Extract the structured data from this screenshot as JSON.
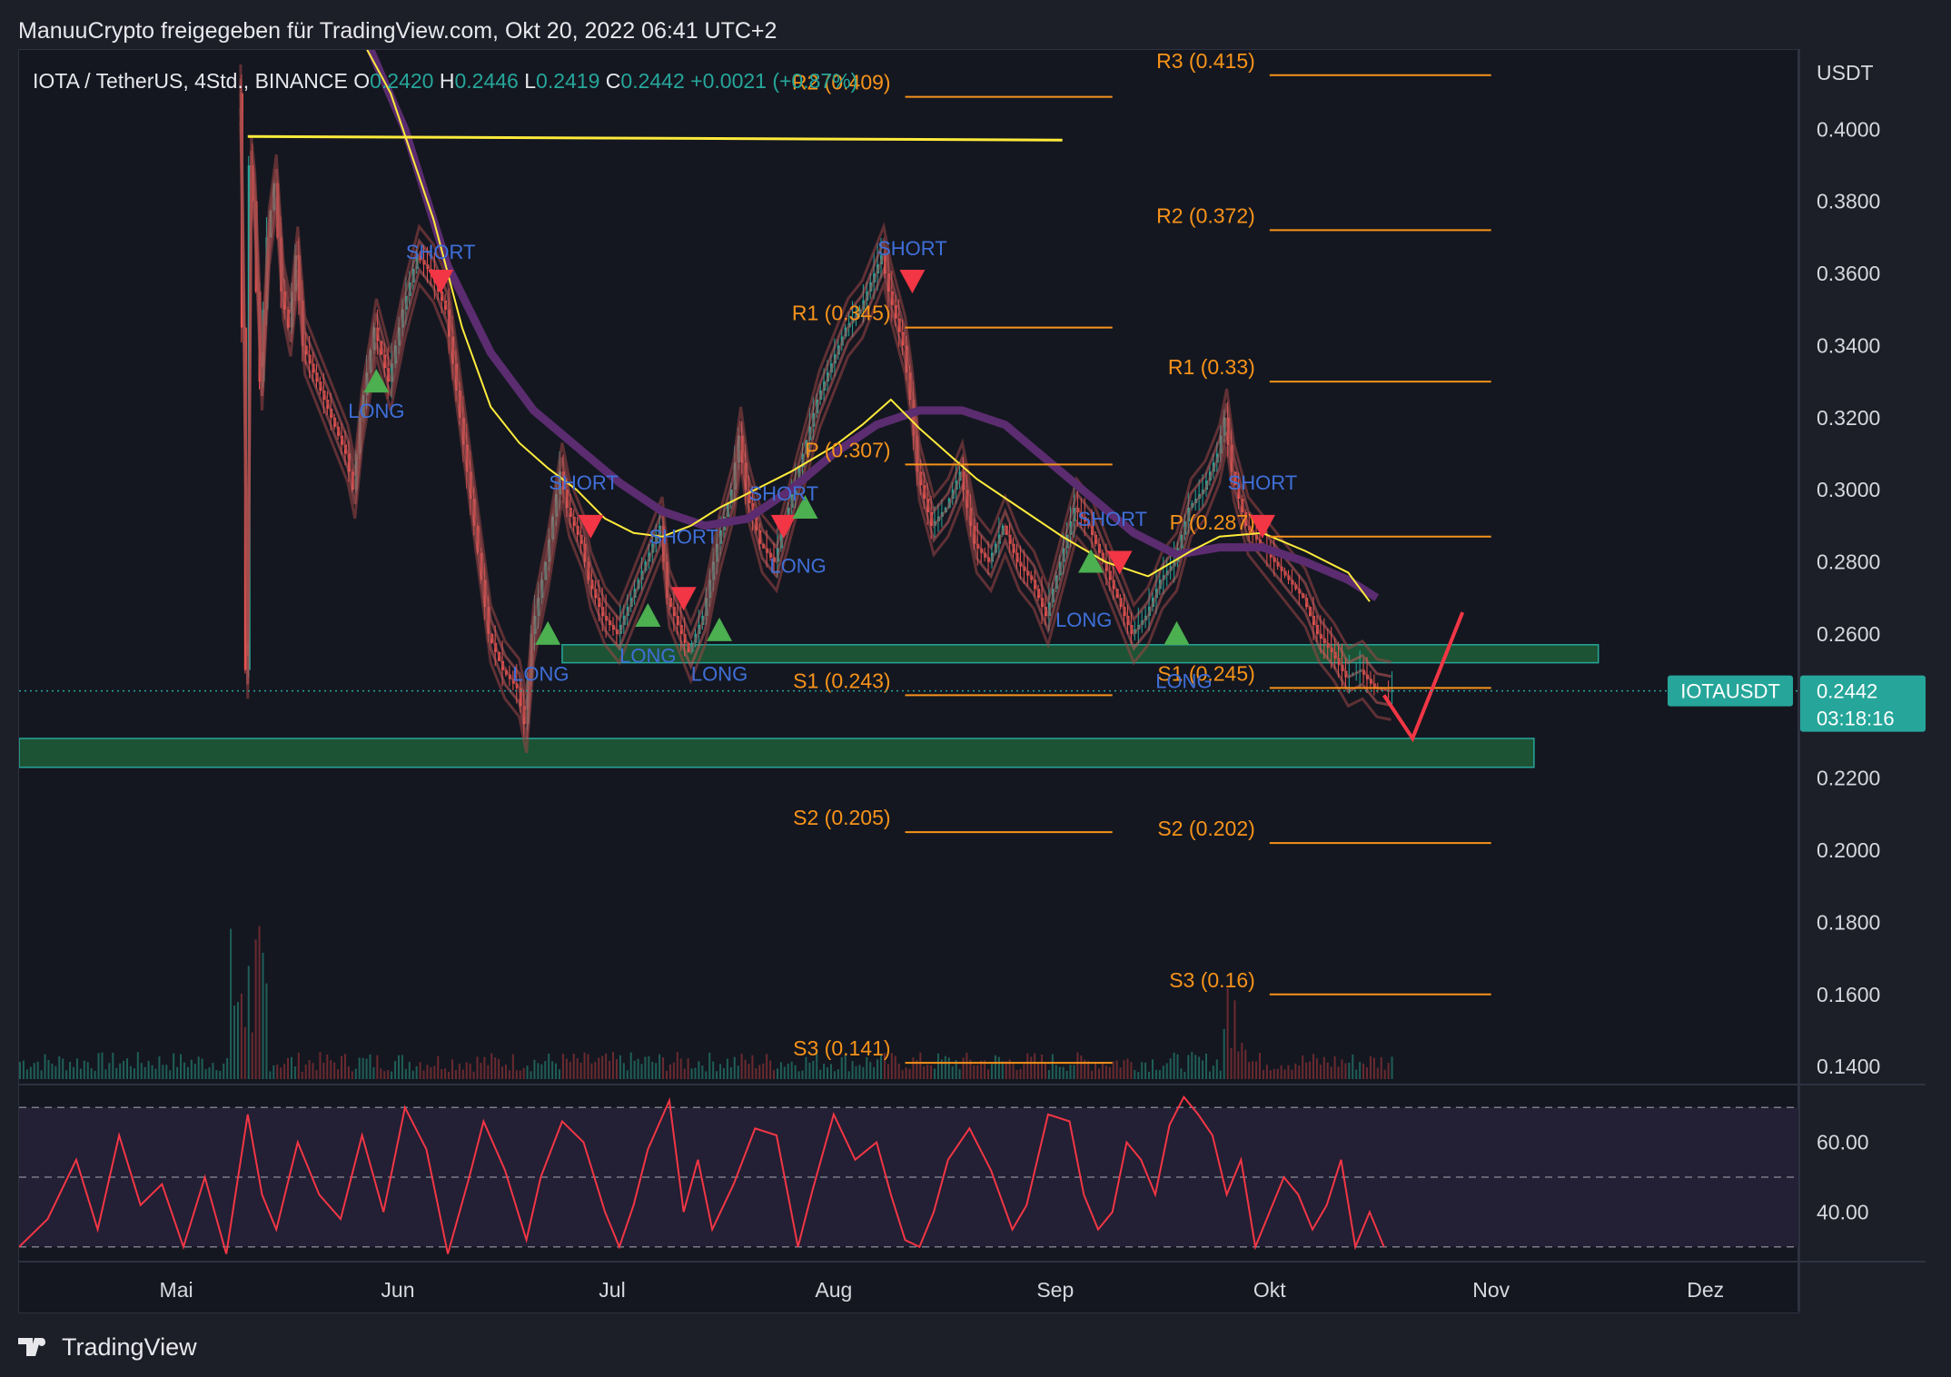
{
  "header": {
    "published_by": "ManuuCrypto freigegeben für TradingView.com, Okt 20, 2022 06:41 UTC+2"
  },
  "footer": {
    "brand": "TradingView"
  },
  "colors": {
    "background": "#141720",
    "up": "#26a69a",
    "down": "#ef5350",
    "ohlc_value": "#26a69a",
    "pivot_line": "#f7931a",
    "resistance_line": "#ffeb3b",
    "ema_slow": "#5b2c6f",
    "ema_fast": "#ffeb3b",
    "zone_fill": "#1e5e3a",
    "zone_border": "#26a69a",
    "rsi_line": "#f23645",
    "long_marker": "#4caf50",
    "short_marker": "#f23645",
    "signal_label": "#3f6fd8",
    "price_tag": "#26a69a"
  },
  "chart_data": {
    "type": "candlestick",
    "symbol_line": {
      "pair": "IOTA / TetherUS, 4Std., BINANCE",
      "o_label": "O",
      "o_value": "0.2420",
      "h_label": "H",
      "h_value": "0.2446",
      "l_label": "L",
      "l_value": "0.2419",
      "c_label": "C",
      "c_value": "0.2442",
      "change": "+0.0021 (+0.87%)"
    },
    "y_axis_unit": "USDT",
    "price_ticks": [
      "0.4000",
      "0.3800",
      "0.3600",
      "0.3400",
      "0.3200",
      "0.3000",
      "0.2800",
      "0.2600",
      "0.2200",
      "0.2000",
      "0.1800",
      "0.1600",
      "0.1400"
    ],
    "ylim": [
      0.136,
      0.422
    ],
    "x_ticks": [
      "Mai",
      "Jun",
      "Jul",
      "Aug",
      "Sep",
      "Okt",
      "Nov",
      "Dez"
    ],
    "x_tick_positions_days": [
      0,
      31,
      61,
      92,
      123,
      153,
      184,
      214
    ],
    "xlim_days": [
      -22,
      227
    ],
    "price_tag": {
      "symbol": "IOTAUSDT",
      "price": "0.2442",
      "countdown": "03:18:16",
      "value": 0.2442
    },
    "price_path": [
      [
        9,
        0.41
      ],
      [
        9.5,
        0.345
      ],
      [
        10,
        0.25
      ],
      [
        10.5,
        0.39
      ],
      [
        11,
        0.38
      ],
      [
        12,
        0.33
      ],
      [
        13,
        0.37
      ],
      [
        14,
        0.385
      ],
      [
        15,
        0.355
      ],
      [
        16,
        0.345
      ],
      [
        17,
        0.365
      ],
      [
        18,
        0.34
      ],
      [
        20,
        0.33
      ],
      [
        22,
        0.32
      ],
      [
        24,
        0.31
      ],
      [
        25,
        0.3
      ],
      [
        26,
        0.32
      ],
      [
        28,
        0.345
      ],
      [
        30,
        0.33
      ],
      [
        32,
        0.35
      ],
      [
        34,
        0.365
      ],
      [
        36,
        0.36
      ],
      [
        38,
        0.35
      ],
      [
        40,
        0.32
      ],
      [
        42,
        0.29
      ],
      [
        44,
        0.26
      ],
      [
        46,
        0.25
      ],
      [
        48,
        0.245
      ],
      [
        49,
        0.235
      ],
      [
        50,
        0.26
      ],
      [
        52,
        0.28
      ],
      [
        54,
        0.305
      ],
      [
        55,
        0.295
      ],
      [
        57,
        0.285
      ],
      [
        58,
        0.275
      ],
      [
        60,
        0.265
      ],
      [
        62,
        0.26
      ],
      [
        64,
        0.27
      ],
      [
        66,
        0.28
      ],
      [
        68,
        0.29
      ],
      [
        69,
        0.27
      ],
      [
        70,
        0.265
      ],
      [
        72,
        0.255
      ],
      [
        74,
        0.265
      ],
      [
        76,
        0.285
      ],
      [
        78,
        0.3
      ],
      [
        79,
        0.315
      ],
      [
        80,
        0.3
      ],
      [
        82,
        0.285
      ],
      [
        84,
        0.28
      ],
      [
        86,
        0.295
      ],
      [
        88,
        0.31
      ],
      [
        90,
        0.325
      ],
      [
        92,
        0.335
      ],
      [
        94,
        0.345
      ],
      [
        96,
        0.35
      ],
      [
        98,
        0.36
      ],
      [
        99,
        0.365
      ],
      [
        100,
        0.355
      ],
      [
        102,
        0.34
      ],
      [
        103,
        0.325
      ],
      [
        104,
        0.305
      ],
      [
        106,
        0.29
      ],
      [
        108,
        0.295
      ],
      [
        110,
        0.305
      ],
      [
        112,
        0.285
      ],
      [
        114,
        0.28
      ],
      [
        116,
        0.29
      ],
      [
        118,
        0.28
      ],
      [
        120,
        0.275
      ],
      [
        122,
        0.265
      ],
      [
        124,
        0.28
      ],
      [
        126,
        0.295
      ],
      [
        128,
        0.29
      ],
      [
        130,
        0.28
      ],
      [
        132,
        0.27
      ],
      [
        134,
        0.26
      ],
      [
        136,
        0.265
      ],
      [
        138,
        0.275
      ],
      [
        140,
        0.28
      ],
      [
        142,
        0.295
      ],
      [
        144,
        0.3
      ],
      [
        146,
        0.31
      ],
      [
        147,
        0.32
      ],
      [
        148,
        0.305
      ],
      [
        150,
        0.29
      ],
      [
        152,
        0.285
      ],
      [
        154,
        0.28
      ],
      [
        156,
        0.275
      ],
      [
        158,
        0.27
      ],
      [
        160,
        0.26
      ],
      [
        162,
        0.255
      ],
      [
        164,
        0.248
      ],
      [
        166,
        0.25
      ],
      [
        168,
        0.245
      ],
      [
        170,
        0.2442
      ]
    ],
    "ema_slow_path": [
      [
        25,
        0.432
      ],
      [
        32,
        0.4
      ],
      [
        38,
        0.362
      ],
      [
        44,
        0.338
      ],
      [
        50,
        0.322
      ],
      [
        56,
        0.312
      ],
      [
        62,
        0.302
      ],
      [
        68,
        0.294
      ],
      [
        74,
        0.29
      ],
      [
        80,
        0.292
      ],
      [
        86,
        0.3
      ],
      [
        92,
        0.31
      ],
      [
        98,
        0.318
      ],
      [
        104,
        0.322
      ],
      [
        110,
        0.322
      ],
      [
        116,
        0.318
      ],
      [
        122,
        0.308
      ],
      [
        128,
        0.298
      ],
      [
        134,
        0.288
      ],
      [
        140,
        0.282
      ],
      [
        146,
        0.284
      ],
      [
        152,
        0.284
      ],
      [
        158,
        0.28
      ],
      [
        164,
        0.275
      ],
      [
        168,
        0.27
      ]
    ],
    "ema_fast_path": [
      [
        24,
        0.432
      ],
      [
        30,
        0.41
      ],
      [
        36,
        0.375
      ],
      [
        40,
        0.345
      ],
      [
        44,
        0.323
      ],
      [
        48,
        0.313
      ],
      [
        52,
        0.306
      ],
      [
        56,
        0.3
      ],
      [
        60,
        0.292
      ],
      [
        64,
        0.288
      ],
      [
        68,
        0.287
      ],
      [
        72,
        0.29
      ],
      [
        76,
        0.295
      ],
      [
        80,
        0.299
      ],
      [
        86,
        0.305
      ],
      [
        92,
        0.312
      ],
      [
        96,
        0.318
      ],
      [
        100,
        0.325
      ],
      [
        104,
        0.317
      ],
      [
        108,
        0.31
      ],
      [
        112,
        0.303
      ],
      [
        118,
        0.295
      ],
      [
        124,
        0.287
      ],
      [
        130,
        0.28
      ],
      [
        136,
        0.276
      ],
      [
        142,
        0.283
      ],
      [
        146,
        0.287
      ],
      [
        152,
        0.288
      ],
      [
        158,
        0.283
      ],
      [
        164,
        0.277
      ],
      [
        167,
        0.269
      ]
    ],
    "resistance_line": {
      "from": 10,
      "to": 124,
      "y1": 0.398,
      "y2": 0.397
    },
    "zones": [
      {
        "from": 54,
        "to": 199,
        "top": 0.257,
        "bottom": 0.252
      },
      {
        "from": -22,
        "to": 190,
        "top": 0.231,
        "bottom": 0.223
      }
    ],
    "projection_path": [
      [
        169,
        0.243
      ],
      [
        173,
        0.231
      ],
      [
        180,
        0.266
      ]
    ],
    "pivot_levels": [
      {
        "label": "R2 (0.409)",
        "value": 0.409,
        "from": 102,
        "to": 131
      },
      {
        "label": "R1 (0.345)",
        "value": 0.345,
        "from": 102,
        "to": 131
      },
      {
        "label": "P (0.307)",
        "value": 0.307,
        "from": 102,
        "to": 131
      },
      {
        "label": "S1 (0.243)",
        "value": 0.243,
        "from": 102,
        "to": 131
      },
      {
        "label": "S2 (0.205)",
        "value": 0.205,
        "from": 102,
        "to": 131
      },
      {
        "label": "S3 (0.141)",
        "value": 0.141,
        "from": 102,
        "to": 131
      },
      {
        "label": "R3 (0.415)",
        "value": 0.415,
        "from": 153,
        "to": 184
      },
      {
        "label": "R2 (0.372)",
        "value": 0.372,
        "from": 153,
        "to": 184
      },
      {
        "label": "R1 (0.33)",
        "value": 0.33,
        "from": 153,
        "to": 184
      },
      {
        "label": "P (0.287)",
        "value": 0.287,
        "from": 153,
        "to": 184
      },
      {
        "label": "S1 (0.245)",
        "value": 0.245,
        "from": 153,
        "to": 184
      },
      {
        "label": "S2 (0.202)",
        "value": 0.202,
        "from": 153,
        "to": 184
      },
      {
        "label": "S3 (0.16)",
        "value": 0.16,
        "from": 153,
        "to": 184
      }
    ],
    "signals": [
      {
        "type": "SHORT",
        "day": 37,
        "price": 0.358
      },
      {
        "type": "LONG",
        "day": 28,
        "price": 0.33
      },
      {
        "type": "LONG",
        "day": 52,
        "price": 0.26
      },
      {
        "type": "SHORT",
        "day": 58,
        "price": 0.29
      },
      {
        "type": "LONG",
        "day": 66,
        "price": 0.265
      },
      {
        "type": "SHORT",
        "day": 71,
        "price": 0.27
      },
      {
        "type": "LONG",
        "day": 76,
        "price": 0.261
      },
      {
        "type": "SHORT",
        "day": 85,
        "price": 0.29
      },
      {
        "type": "LONG",
        "day": 88,
        "price": 0.295
      },
      {
        "type": "SHORT",
        "day": 103,
        "price": 0.358
      },
      {
        "type": "LONG",
        "day": 128,
        "price": 0.28
      },
      {
        "type": "SHORT",
        "day": 132,
        "price": 0.28
      },
      {
        "type": "LONG",
        "day": 140,
        "price": 0.26
      },
      {
        "type": "SHORT",
        "day": 152,
        "price": 0.29
      }
    ],
    "signal_labels": [
      {
        "text": "SHORT",
        "day": 37,
        "price": 0.364
      },
      {
        "text": "LONG",
        "day": 28,
        "price": 0.32
      },
      {
        "text": "SHORT",
        "day": 57,
        "price": 0.3
      },
      {
        "text": "LONG",
        "day": 51,
        "price": 0.247
      },
      {
        "text": "SHORT",
        "day": 71,
        "price": 0.285
      },
      {
        "text": "LONG",
        "day": 66,
        "price": 0.252
      },
      {
        "text": "LONG",
        "day": 76,
        "price": 0.247
      },
      {
        "text": "SHORT",
        "day": 85,
        "price": 0.297
      },
      {
        "text": "LONG",
        "day": 87,
        "price": 0.277
      },
      {
        "text": "SHORT",
        "day": 103,
        "price": 0.365
      },
      {
        "text": "SHORT",
        "day": 131,
        "price": 0.29
      },
      {
        "text": "LONG",
        "day": 127,
        "price": 0.262
      },
      {
        "text": "LONG",
        "day": 141,
        "price": 0.245
      },
      {
        "text": "SHORT",
        "day": 152,
        "price": 0.3
      }
    ],
    "rsi": {
      "ticks": [
        "60.00",
        "40.00"
      ],
      "tick_values": [
        60,
        40
      ],
      "bands": [
        70,
        50,
        30
      ],
      "ylim": [
        25,
        75
      ],
      "path": [
        [
          -22,
          30
        ],
        [
          -18,
          38
        ],
        [
          -14,
          55
        ],
        [
          -11,
          35
        ],
        [
          -8,
          62
        ],
        [
          -5,
          42
        ],
        [
          -2,
          48
        ],
        [
          1,
          30
        ],
        [
          4,
          50
        ],
        [
          7,
          28
        ],
        [
          10,
          68
        ],
        [
          12,
          45
        ],
        [
          14,
          35
        ],
        [
          17,
          60
        ],
        [
          20,
          45
        ],
        [
          23,
          38
        ],
        [
          26,
          62
        ],
        [
          29,
          40
        ],
        [
          32,
          70
        ],
        [
          35,
          58
        ],
        [
          38,
          28
        ],
        [
          41,
          50
        ],
        [
          43,
          66
        ],
        [
          46,
          52
        ],
        [
          49,
          32
        ],
        [
          51,
          50
        ],
        [
          54,
          66
        ],
        [
          57,
          60
        ],
        [
          60,
          40
        ],
        [
          62,
          30
        ],
        [
          64,
          42
        ],
        [
          66,
          58
        ],
        [
          69,
          72
        ],
        [
          71,
          40
        ],
        [
          73,
          55
        ],
        [
          75,
          35
        ],
        [
          78,
          48
        ],
        [
          81,
          64
        ],
        [
          84,
          62
        ],
        [
          87,
          30
        ],
        [
          89,
          46
        ],
        [
          92,
          68
        ],
        [
          95,
          55
        ],
        [
          98,
          60
        ],
        [
          100,
          45
        ],
        [
          102,
          32
        ],
        [
          104,
          30
        ],
        [
          106,
          40
        ],
        [
          108,
          55
        ],
        [
          111,
          64
        ],
        [
          114,
          52
        ],
        [
          117,
          35
        ],
        [
          119,
          42
        ],
        [
          122,
          68
        ],
        [
          125,
          66
        ],
        [
          127,
          45
        ],
        [
          129,
          35
        ],
        [
          131,
          40
        ],
        [
          133,
          60
        ],
        [
          135,
          55
        ],
        [
          137,
          45
        ],
        [
          139,
          65
        ],
        [
          141,
          73
        ],
        [
          143,
          68
        ],
        [
          145,
          62
        ],
        [
          147,
          45
        ],
        [
          149,
          55
        ],
        [
          151,
          30
        ],
        [
          153,
          40
        ],
        [
          155,
          50
        ],
        [
          157,
          45
        ],
        [
          159,
          35
        ],
        [
          161,
          42
        ],
        [
          163,
          55
        ],
        [
          165,
          30
        ],
        [
          167,
          40
        ],
        [
          169,
          30
        ]
      ]
    }
  }
}
